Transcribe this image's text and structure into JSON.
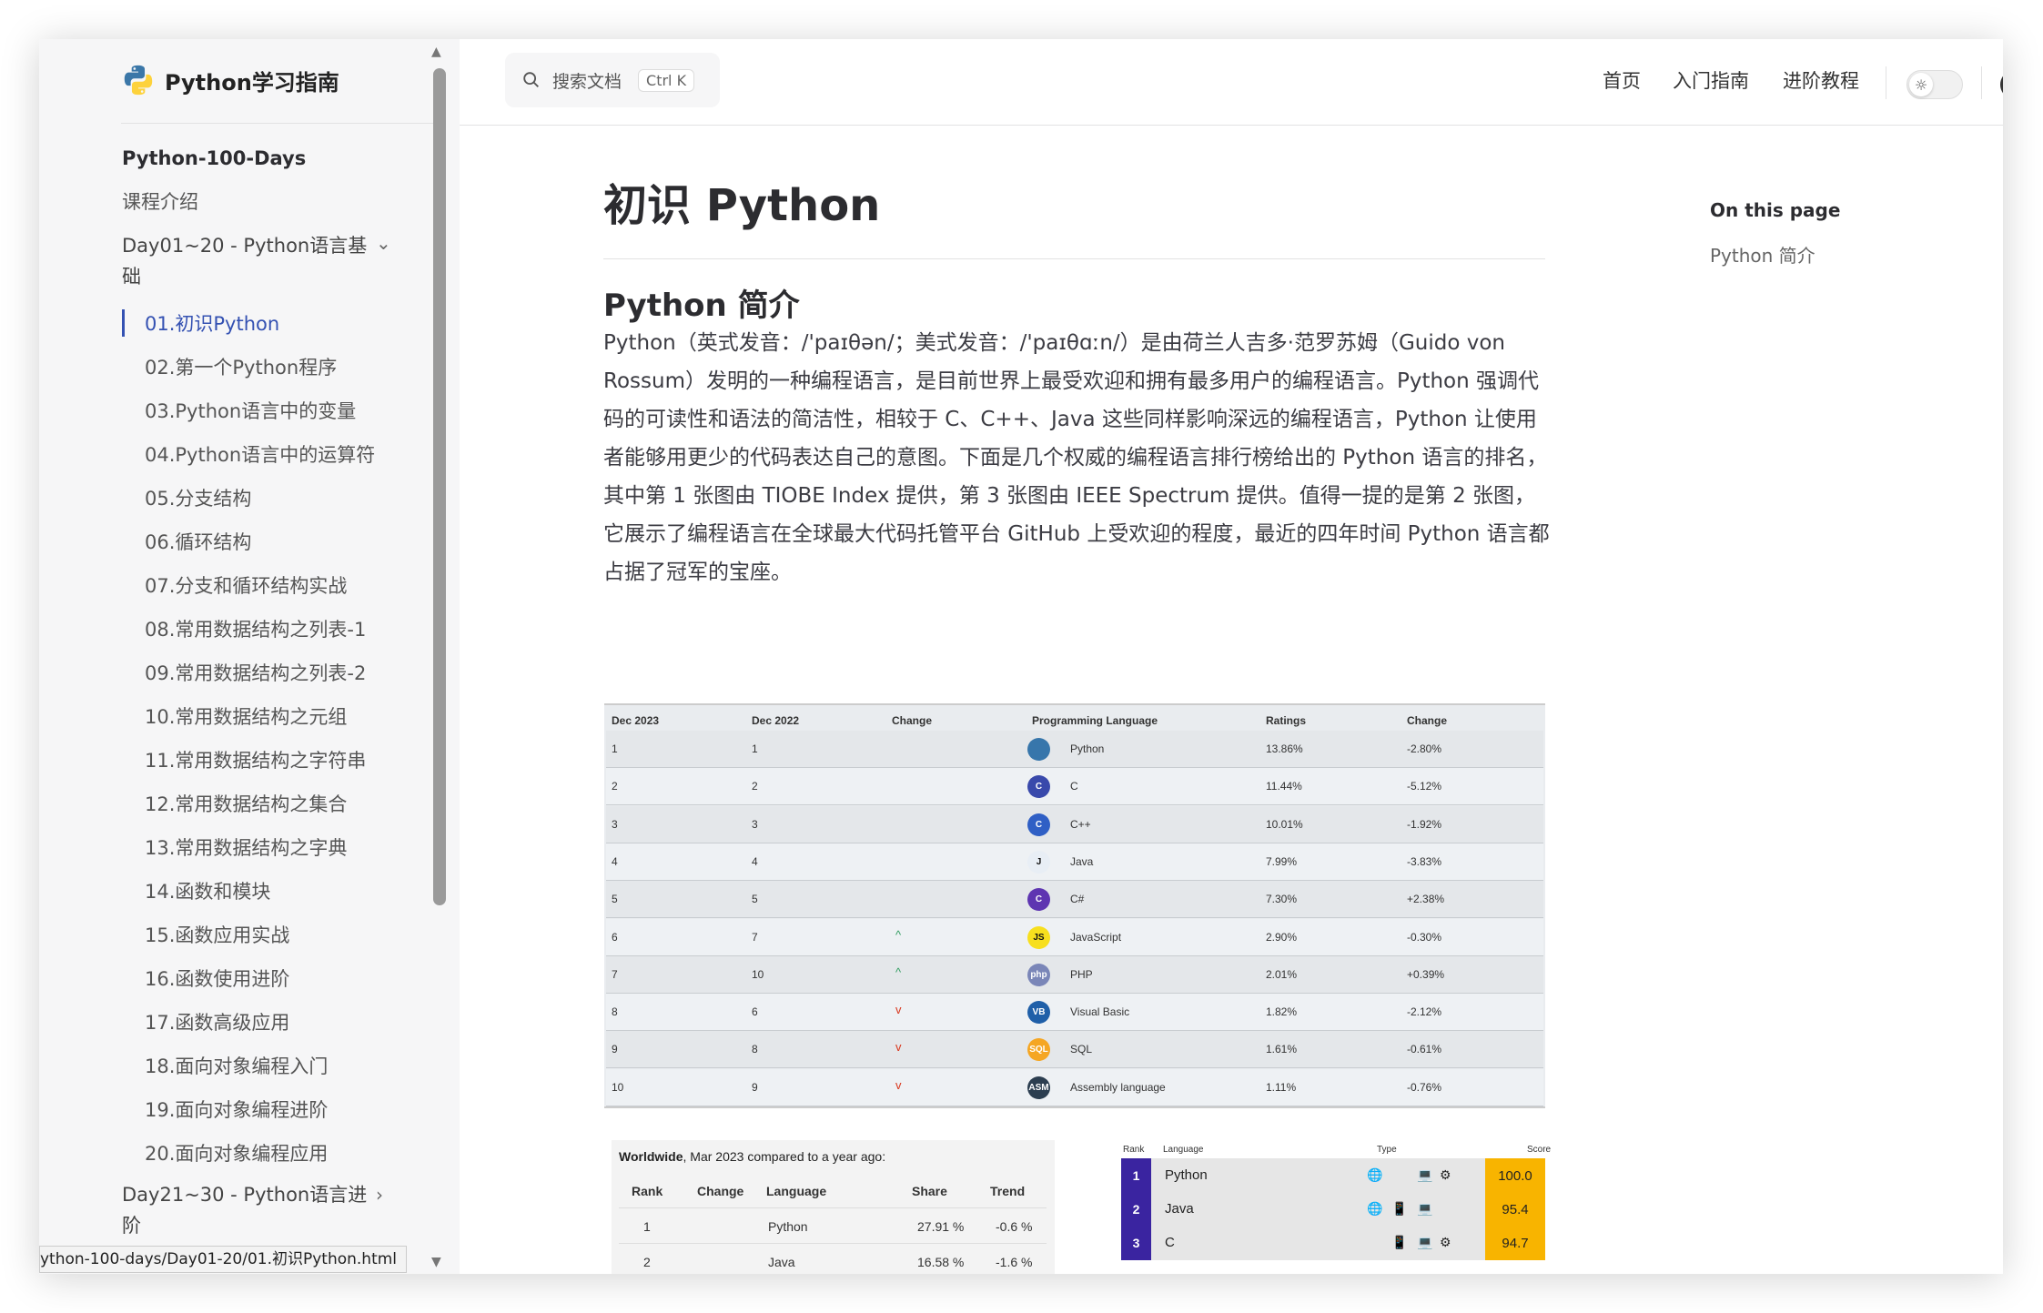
{
  "site": {
    "title": "Python学习指南"
  },
  "sidebar": {
    "section_title": "Python-100-Days",
    "intro": "课程介绍",
    "group1": "Day01~20 - Python语言基础",
    "group1_items": [
      "01.初识Python",
      "02.第一个Python程序",
      "03.Python语言中的变量",
      "04.Python语言中的运算符",
      "05.分支结构",
      "06.循环结构",
      "07.分支和循环结构实战",
      "08.常用数据结构之列表-1",
      "09.常用数据结构之列表-2",
      "10.常用数据结构之元组",
      "11.常用数据结构之字符串",
      "12.常用数据结构之集合",
      "13.常用数据结构之字典",
      "14.函数和模块",
      "15.函数应用实战",
      "16.函数使用进阶",
      "17.函数高级应用",
      "18.面向对象编程入门",
      "19.面向对象编程进阶",
      "20.面向对象编程应用"
    ],
    "group2": "Day21~30 - Python语言进阶"
  },
  "status_url": "ython-100-days/Day01-20/01.初识Python.html",
  "topbar": {
    "search_placeholder": "搜索文档",
    "search_shortcut": "Ctrl K",
    "nav": [
      "首页",
      "入门指南",
      "进阶教程"
    ]
  },
  "content": {
    "title": "初识 Python",
    "h2": "Python 简介",
    "paragraph": "Python（英式发音：/'paɪθən/；美式发音：/'paɪθɑːn/）是由荷兰人吉多·范罗苏姆（Guido von Rossum）发明的一种编程语言，是目前世界上最受欢迎和拥有最多用户的编程语言。Python 强调代码的可读性和语法的简洁性，相较于 C、C++、Java 这些同样影响深远的编程语言，Python 让使用者能够用更少的代码表达自己的意图。下面是几个权威的编程语言排行榜给出的 Python 语言的排名，其中第 1 张图由 TIOBE Index 提供，第 3 张图由 IEEE Spectrum 提供。值得一提的是第 2 张图，它展示了编程语言在全球最大代码托管平台 GitHub 上受欢迎的程度，最近的四年时间 Python 语言都占据了冠军的宝座。"
  },
  "outline": {
    "title": "On this page",
    "link": "Python 简介"
  },
  "tiobe": {
    "headers": [
      "Dec 2023",
      "Dec 2022",
      "Change",
      "Programming Language",
      "Ratings",
      "Change"
    ],
    "rows": [
      {
        "r1": "1",
        "r2": "1",
        "lang": "Python",
        "rating": "13.86%",
        "change": "-2.80%",
        "arrow": "",
        "logo": "",
        "color": "#3776ab"
      },
      {
        "r1": "2",
        "r2": "2",
        "lang": "C",
        "rating": "11.44%",
        "change": "-5.12%",
        "arrow": "",
        "logo": "C",
        "color": "#3949ab"
      },
      {
        "r1": "3",
        "r2": "3",
        "lang": "C++",
        "rating": "10.01%",
        "change": "-1.92%",
        "arrow": "",
        "logo": "C",
        "color": "#2f5fc5"
      },
      {
        "r1": "4",
        "r2": "4",
        "lang": "Java",
        "rating": "7.99%",
        "change": "-3.83%",
        "arrow": "",
        "logo": "J",
        "color": "#e8eef5"
      },
      {
        "r1": "5",
        "r2": "5",
        "lang": "C#",
        "rating": "7.30%",
        "change": "+2.38%",
        "arrow": "",
        "logo": "C",
        "color": "#5e35b1"
      },
      {
        "r1": "6",
        "r2": "7",
        "lang": "JavaScript",
        "rating": "2.90%",
        "change": "-0.30%",
        "arrow": "^",
        "logo": "JS",
        "color": "#f7df1e"
      },
      {
        "r1": "7",
        "r2": "10",
        "lang": "PHP",
        "rating": "2.01%",
        "change": "+0.39%",
        "arrow": "^",
        "logo": "php",
        "color": "#7a86b8"
      },
      {
        "r1": "8",
        "r2": "6",
        "lang": "Visual Basic",
        "rating": "1.82%",
        "change": "-2.12%",
        "arrow": "v",
        "logo": "VB",
        "color": "#1f5fa8"
      },
      {
        "r1": "9",
        "r2": "8",
        "lang": "SQL",
        "rating": "1.61%",
        "change": "-0.61%",
        "arrow": "v",
        "logo": "SQL",
        "color": "#f5a623"
      },
      {
        "r1": "10",
        "r2": "9",
        "lang": "Assembly language",
        "rating": "1.11%",
        "change": "-0.76%",
        "arrow": "v",
        "logo": "ASM",
        "color": "#2c3e50"
      }
    ]
  },
  "worldwide": {
    "caption_bold": "Worldwide",
    "caption_rest": ", Mar 2023 compared to a year ago:",
    "headers": [
      "Rank",
      "Change",
      "Language",
      "Share",
      "Trend"
    ],
    "rows": [
      {
        "rank": "1",
        "lang": "Python",
        "share": "27.91 %",
        "trend": "-0.6 %"
      },
      {
        "rank": "2",
        "lang": "Java",
        "share": "16.58 %",
        "trend": "-1.6 %"
      }
    ]
  },
  "ieee": {
    "headers": [
      "Rank",
      "Language",
      "Type",
      "Score"
    ],
    "rows": [
      {
        "rank": "1",
        "lang": "Python",
        "score": "100.0"
      },
      {
        "rank": "2",
        "lang": "Java",
        "score": "95.4"
      },
      {
        "rank": "3",
        "lang": "C",
        "score": "94.7"
      }
    ]
  },
  "colors": {
    "accent": "#3451b2",
    "rank_bg": "#3a24a0",
    "score_bg": "#f8b400"
  }
}
